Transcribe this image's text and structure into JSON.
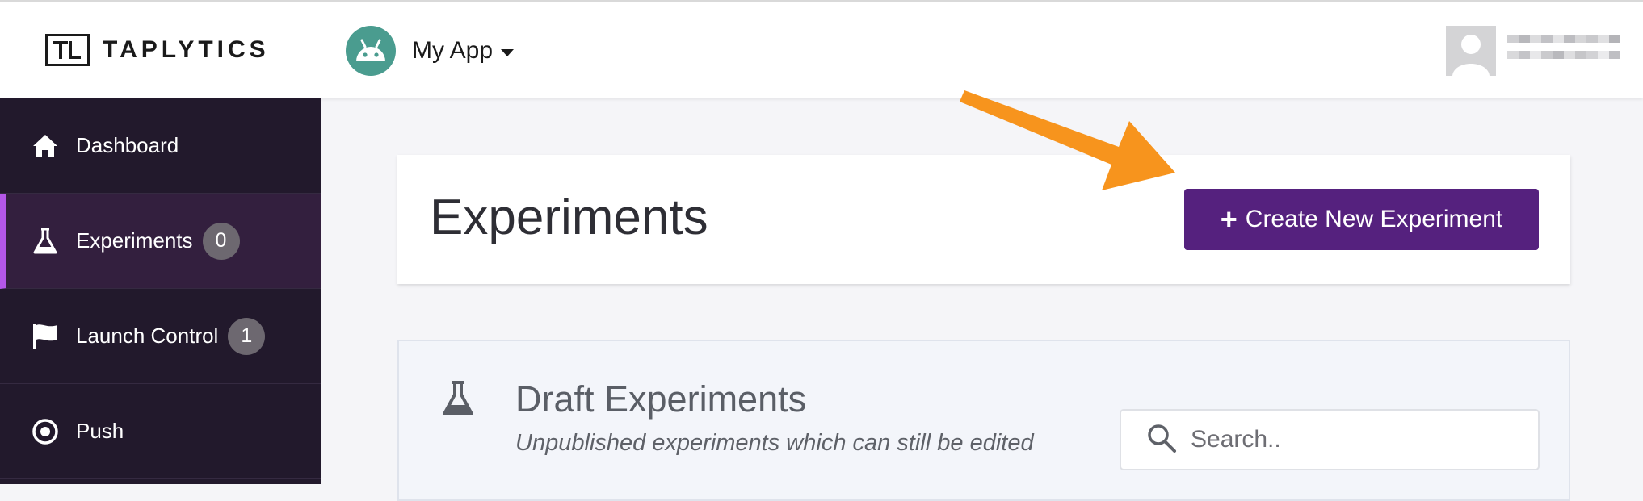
{
  "brand": {
    "name": "TAPLYTICS"
  },
  "app": {
    "name": "My App"
  },
  "sidebar": {
    "items": [
      {
        "label": "Dashboard",
        "icon": "home-icon"
      },
      {
        "label": "Experiments",
        "icon": "flask-icon",
        "badge": "0",
        "active": true
      },
      {
        "label": "Launch Control",
        "icon": "flag-icon",
        "badge": "1"
      },
      {
        "label": "Push",
        "icon": "target-icon"
      }
    ]
  },
  "header": {
    "title": "Experiments",
    "create_label": "Create New Experiment"
  },
  "draft": {
    "title": "Draft Experiments",
    "subtitle": "Unpublished experiments which can still be edited",
    "search_placeholder": "Search.."
  },
  "colors": {
    "sidebar_bg": "#22192c",
    "active_accent": "#b457e8",
    "primary_button": "#55217e",
    "annotation_arrow": "#f7941d"
  }
}
